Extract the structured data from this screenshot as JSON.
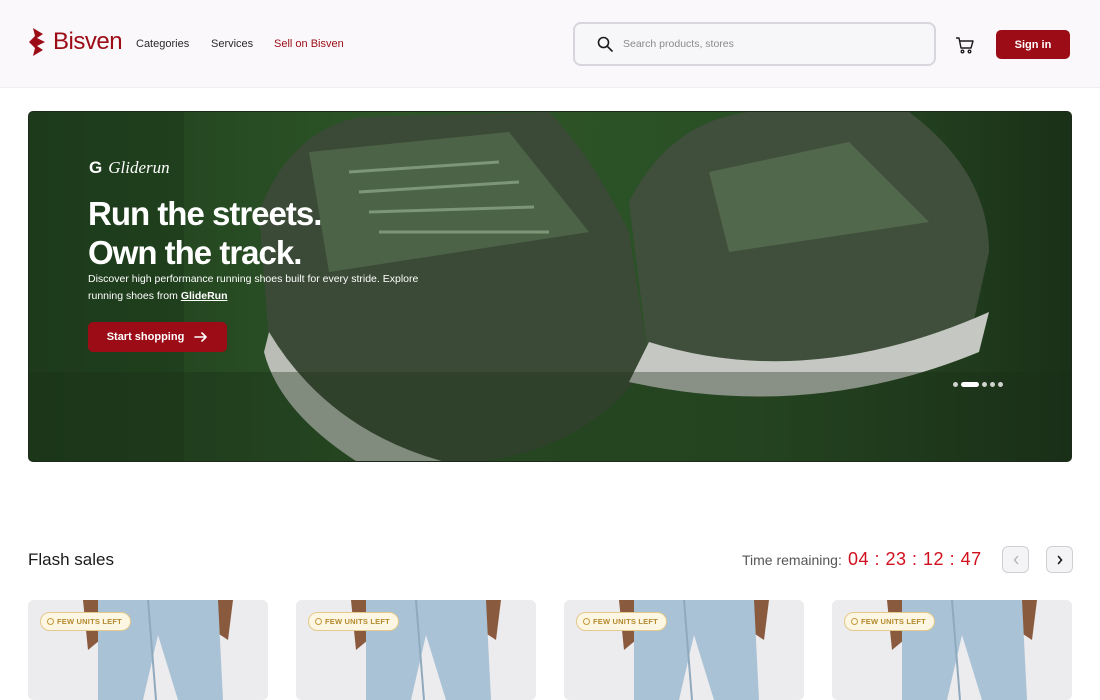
{
  "header": {
    "logo_text": "Bisven",
    "nav": [
      "Categories",
      "Services",
      "Sell on Bisven"
    ],
    "search_placeholder": "Search products, stores",
    "sign_in_label": "Sign in"
  },
  "hero": {
    "brand_glyph": "G",
    "brand_name": "Gliderun",
    "headline_line1": "Run the streets.",
    "headline_line2": "Own the track.",
    "description": "Discover high performance running shoes built for every stride. Explore running shoes from",
    "description_link": "GlideRun",
    "cta_label": "Start shopping",
    "slides_count": 5,
    "active_slide": 2
  },
  "flash_sales": {
    "title": "Flash sales",
    "timer_label": "Time remaining:",
    "timer": "04 : 23 : 12 : 47",
    "products": [
      {
        "badge": "FEW UNITS LEFT"
      },
      {
        "badge": "FEW UNITS LEFT"
      },
      {
        "badge": "FEW UNITS LEFT"
      },
      {
        "badge": "FEW UNITS LEFT"
      }
    ]
  },
  "colors": {
    "brand": "#9b0c16",
    "timer": "#d0101f",
    "hero_bg": "#23431f"
  }
}
